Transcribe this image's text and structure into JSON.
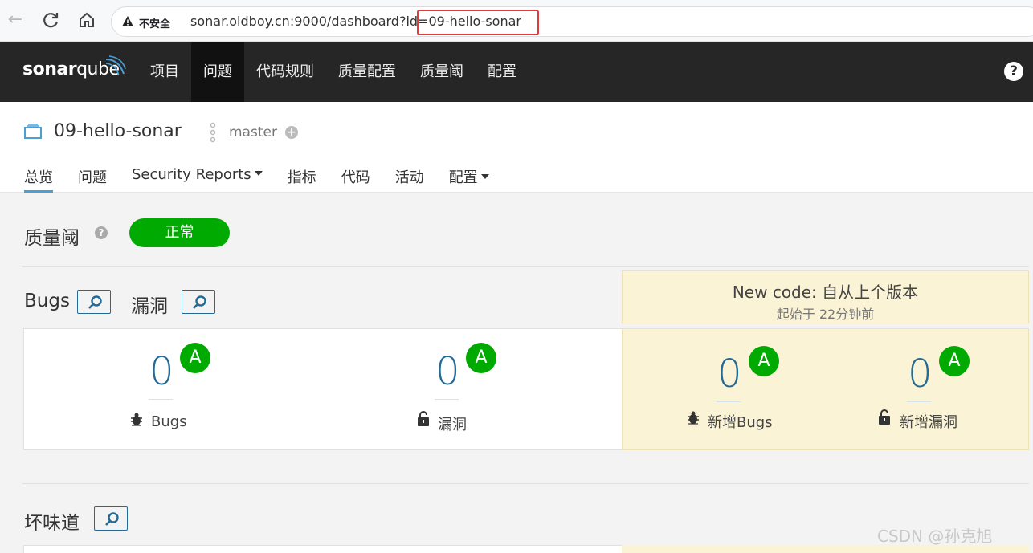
{
  "browser": {
    "insecure_label": "不安全",
    "url": "sonar.oldboy.cn:9000/dashboard?id=09-hello-sonar",
    "url_prefix": "sonar.oldboy.cn:9000/dashboard?id=",
    "url_highlight": "09-hello-sonar"
  },
  "topnav": {
    "logo_bold": "sonar",
    "logo_light": "qube",
    "items": [
      "项目",
      "问题",
      "代码规则",
      "质量配置",
      "质量阈",
      "配置"
    ],
    "help": "?"
  },
  "project": {
    "name": "09-hello-sonar",
    "branch": "master",
    "tabs": [
      {
        "label": "总览"
      },
      {
        "label": "问题"
      },
      {
        "label": "Security Reports"
      },
      {
        "label": "指标"
      },
      {
        "label": "代码"
      },
      {
        "label": "活动"
      },
      {
        "label": "配置"
      }
    ]
  },
  "quality_gate": {
    "title": "质量阈",
    "status": "正常",
    "status_color": "#00aa00"
  },
  "bugs_section": {
    "bugs_title": "Bugs",
    "vuln_title": "漏洞",
    "new_code_title": "New code: 自从上个版本",
    "new_code_sub": "起始于 22分钟前",
    "metrics": [
      {
        "value": "0",
        "rating": "A",
        "label": "Bugs"
      },
      {
        "value": "0",
        "rating": "A",
        "label": "漏洞"
      },
      {
        "value": "0",
        "rating": "A",
        "label": "新增Bugs"
      },
      {
        "value": "0",
        "rating": "A",
        "label": "新增漏洞"
      }
    ]
  },
  "smells_section": {
    "title": "坏味道"
  },
  "watermark": "CSDN @孙克旭",
  "colors": {
    "accent": "#236a97",
    "rating_a": "#00aa00",
    "new_code_bg": "#fbf3d5",
    "nav_bg": "#262626"
  }
}
